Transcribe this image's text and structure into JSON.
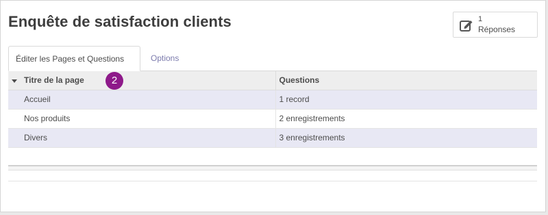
{
  "page": {
    "title": "Enquête de satisfaction clients"
  },
  "stat_button": {
    "count": "1",
    "label": "Réponses",
    "icon": "edit-icon"
  },
  "tabs": [
    {
      "label": "Éditer les Pages et Questions",
      "active": true
    },
    {
      "label": "Options",
      "active": false
    }
  ],
  "table": {
    "columns": [
      "Titre de la page",
      "Questions"
    ],
    "rows": [
      {
        "title": "Accueil",
        "questions": "1 record"
      },
      {
        "title": "Nos produits",
        "questions": "2 enregistrements"
      },
      {
        "title": "Divers",
        "questions": "3 enregistrements"
      }
    ]
  },
  "annotation": {
    "badge": "2"
  },
  "colors": {
    "accent": "#7c7bad",
    "badge": "#8e1a8a",
    "row_highlight": "#e8e8f4"
  }
}
